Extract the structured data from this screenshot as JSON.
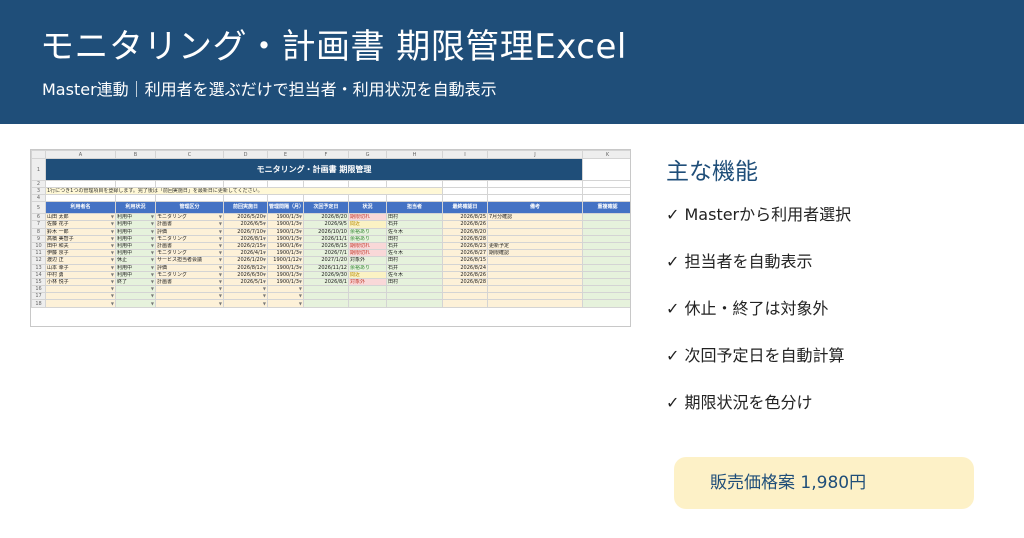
{
  "header": {
    "title": "モニタリング・計画書 期限管理Excel",
    "subtitle": "Master連動｜利用者を選ぶだけで担当者・利用状況を自動表示"
  },
  "sheet": {
    "columns": [
      "A",
      "B",
      "C",
      "D",
      "E",
      "F",
      "G",
      "H",
      "I",
      "J",
      "K"
    ],
    "banner": "モニタリング・計画書 期限管理",
    "note": "1行につき1つの管理項目を登録します。完了後は「前回実施日」を最新日に更新してください。",
    "headers": [
      "利用者名",
      "利用状況",
      "管理区分",
      "前回実施日",
      "管理間隔（月）",
      "次回予定日",
      "状況",
      "担当者",
      "最終確認日",
      "備考",
      "重複確認"
    ],
    "rows": [
      {
        "num": "6",
        "name": "山田 太郎",
        "use": "利用中",
        "cat": "モニタリング",
        "prev": "2026/5/20",
        "interval": "1900/1/3",
        "next": "2026/8/20",
        "status": "期限切れ",
        "tone": "red",
        "staff": "田村",
        "checked": "2026/8/25",
        "memo": "7月分確認"
      },
      {
        "num": "7",
        "name": "佐藤 花子",
        "use": "利用中",
        "cat": "計画書",
        "prev": "2026/6/5",
        "interval": "1900/1/3",
        "next": "2026/9/5",
        "status": "間近",
        "tone": "yel",
        "staff": "石井",
        "checked": "2026/8/26",
        "memo": ""
      },
      {
        "num": "8",
        "name": "鈴木 一郎",
        "use": "利用中",
        "cat": "評価",
        "prev": "2026/7/10",
        "interval": "1900/1/3",
        "next": "2026/10/10",
        "status": "余裕あり",
        "tone": "grn",
        "staff": "佐々木",
        "checked": "2026/8/20",
        "memo": ""
      },
      {
        "num": "9",
        "name": "高橋 美智子",
        "use": "利用中",
        "cat": "モニタリング",
        "prev": "2026/8/1",
        "interval": "1900/1/3",
        "next": "2026/11/1",
        "status": "余裕あり",
        "tone": "grn",
        "staff": "田村",
        "checked": "2026/8/28",
        "memo": ""
      },
      {
        "num": "10",
        "name": "田中 和夫",
        "use": "利用中",
        "cat": "計画書",
        "prev": "2026/2/15",
        "interval": "1900/1/6",
        "next": "2026/8/15",
        "status": "期限切れ",
        "tone": "red",
        "staff": "石井",
        "checked": "2026/8/23",
        "memo": "更新予定"
      },
      {
        "num": "11",
        "name": "伊藤 京子",
        "use": "利用中",
        "cat": "モニタリング",
        "prev": "2026/4/1",
        "interval": "1900/1/3",
        "next": "2026/7/1",
        "status": "期限切れ",
        "tone": "red",
        "staff": "佐々木",
        "checked": "2026/8/27",
        "memo": "期限確認"
      },
      {
        "num": "12",
        "name": "渡辺 正",
        "use": "休止",
        "cat": "サービス担当者会議",
        "prev": "2026/1/20",
        "interval": "1900/1/12",
        "next": "2027/1/20",
        "status": "対象外",
        "tone": "none",
        "staff": "田村",
        "checked": "2026/8/15",
        "memo": ""
      },
      {
        "num": "13",
        "name": "山本 幸子",
        "use": "利用中",
        "cat": "評価",
        "prev": "2026/8/12",
        "interval": "1900/1/3",
        "next": "2026/11/12",
        "status": "余裕あり",
        "tone": "grn",
        "staff": "石井",
        "checked": "2026/8/24",
        "memo": ""
      },
      {
        "num": "14",
        "name": "中村 勇",
        "use": "利用中",
        "cat": "モニタリング",
        "prev": "2026/6/30",
        "interval": "1900/1/3",
        "next": "2026/9/30",
        "status": "間近",
        "tone": "yel",
        "staff": "佐々木",
        "checked": "2026/8/26",
        "memo": ""
      },
      {
        "num": "15",
        "name": "小林 悦子",
        "use": "終了",
        "cat": "計画書",
        "prev": "2026/5/1",
        "interval": "1900/1/3",
        "next": "2026/8/1",
        "status": "対象外",
        "tone": "red",
        "staff": "田村",
        "checked": "2026/8/28",
        "memo": ""
      }
    ],
    "empty_rows": [
      "16",
      "17",
      "18"
    ]
  },
  "features": {
    "title": "主な機能",
    "items": [
      "✓ Masterから利用者選択",
      "✓ 担当者を自動表示",
      "✓ 休止・終了は対象外",
      "✓ 次回予定日を自動計算",
      "✓ 期限状況を色分け"
    ]
  },
  "price": "販売価格案 1,980円",
  "colors": {
    "header_bg": "#1f4e79",
    "sheet_header": "#4472c4",
    "input_cell": "#fdf1d8",
    "formula_cell": "#e6f2dc",
    "price_bg": "#fdf1c7"
  }
}
